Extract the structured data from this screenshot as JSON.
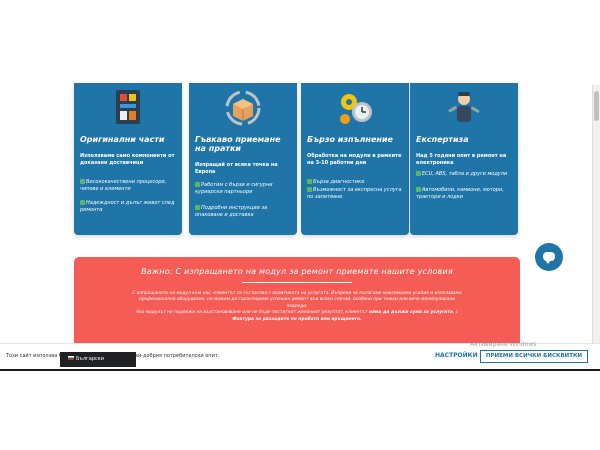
{
  "cards": [
    {
      "title": "Оригинални части",
      "subtitle": "Използваме само компоненти от доказани доставчици",
      "features": [
        "Висококачествени процесори, чипове и елементи",
        "Надеждност и дълъг живот след ремонта"
      ],
      "icon": "circuit-board-icon"
    },
    {
      "title": "Гъвкаво приемане на пратки",
      "subtitle": "Изпращай от всяка точка на Европа",
      "features": [
        "Работим с бързи и сигурни куриерски партньори",
        "Подробни инструкции за опаковане и доставка"
      ],
      "icon": "parcel-box-icon"
    },
    {
      "title": "Бързо изпълнение",
      "subtitle": "Обработка на модули в рамките на 3-10 работни дни",
      "features": [
        "Бърза диагностика",
        "Възможност за експресна услуга по запитване"
      ],
      "icon": "gears-clock-icon"
    },
    {
      "title": "Експертиза",
      "subtitle": "Над 5 години опит в ремонт на електроника",
      "features": [
        "ECU, ABS, табла и други модули",
        "Автомобили, камиони, мотори, трактори и лодки"
      ],
      "icon": "mechanic-icon"
    }
  ],
  "notice": {
    "title": "Важно: С изпращането на модул за ремонт приемате нашите условия",
    "line1": "С изпращането на модул към нас, клиентът се съгласява с политиката на услугата. Въпреки че полагаме максимални усилия и използваме",
    "line2": "професионално оборудване, не можем да гарантираме успешен ремонт във всеки случай, особено при тежки или вече манипулирани",
    "line3": "повреди.",
    "line4_start": "Ако модулът не подлежи на възстановяване или не бъде постигнат желаният резултат, клиентът ",
    "line4_bold": "няма да дължи сума за услугата",
    "line4_end": ", с",
    "line5": "Фактура за разходите по пробата или връщането."
  },
  "cookie": {
    "text_start": "Този сайт използва б",
    "text_end": "ко най-добрия потребителски опит.",
    "settings_label": "НАСТРОЙКИ",
    "accept_label": "ПРИЕМИ ВСИЧКИ БИСКВИТКИ"
  },
  "language": {
    "label": "Български"
  },
  "watermark": "Активиране Windows",
  "colors": {
    "card_blue": "#1f75a8",
    "notice_red": "#f65c56",
    "check_green": "#5cb85c"
  }
}
